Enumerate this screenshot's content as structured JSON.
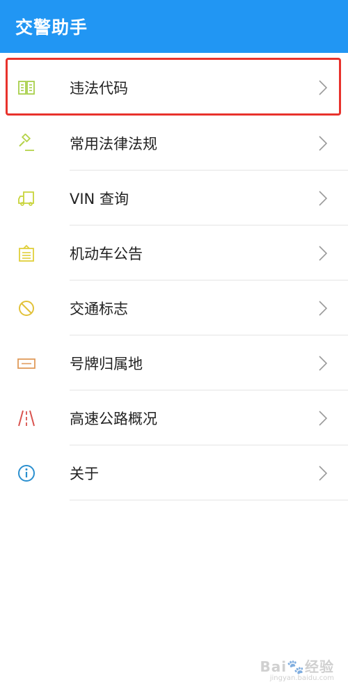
{
  "header": {
    "title": "交警助手",
    "background": "#2196f3"
  },
  "menu": {
    "items": [
      {
        "label": "违法代码",
        "icon": "book-icon",
        "icon_color": "#a8cf4a"
      },
      {
        "label": "常用法律法规",
        "icon": "gavel-icon",
        "icon_color": "#b5d34a"
      },
      {
        "label": "VIN 查询",
        "icon": "truck-icon",
        "icon_color": "#c8d43a"
      },
      {
        "label": "机动车公告",
        "icon": "clipboard-icon",
        "icon_color": "#e0cf3a"
      },
      {
        "label": "交通标志",
        "icon": "no-entry-icon",
        "icon_color": "#e2c23a"
      },
      {
        "label": "号牌归属地",
        "icon": "license-plate-icon",
        "icon_color": "#e09a5a"
      },
      {
        "label": "高速公路概况",
        "icon": "highway-icon",
        "icon_color": "#d9534f"
      },
      {
        "label": "关于",
        "icon": "info-icon",
        "icon_color": "#2a8fcf"
      }
    ]
  },
  "highlight_color": "#e8322c",
  "watermark": {
    "main": "Bai🐾经验",
    "sub": "jingyan.baidu.com"
  }
}
